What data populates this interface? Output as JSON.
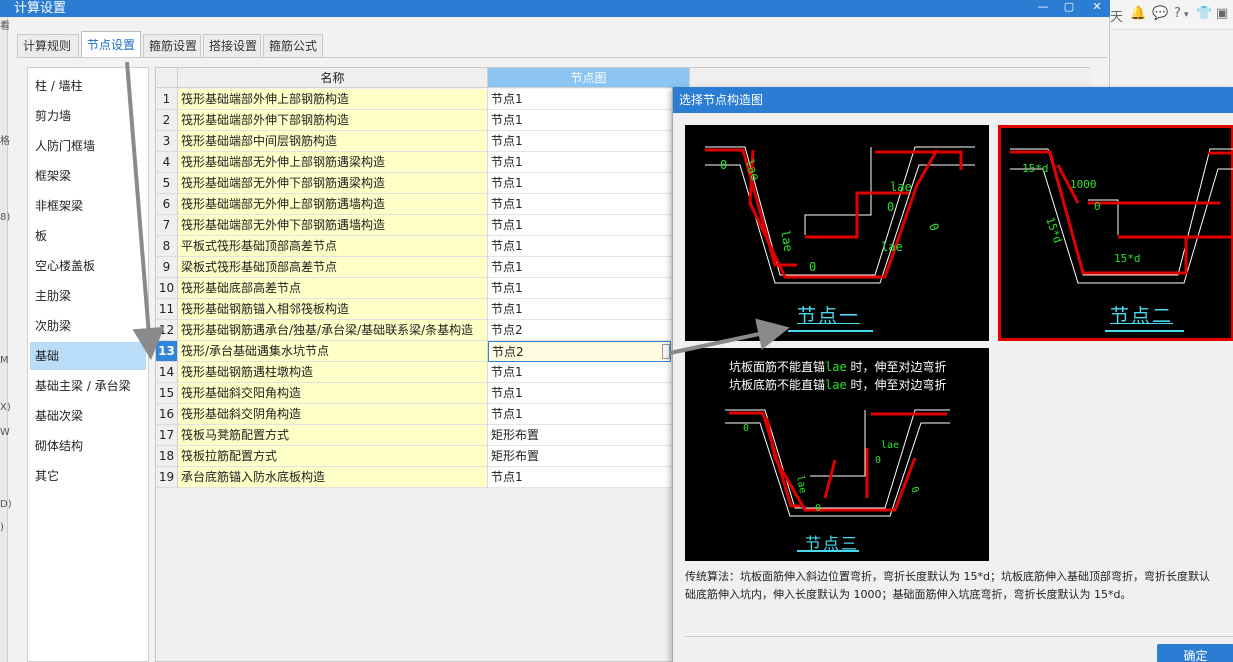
{
  "window": {
    "title": "计算设置",
    "controls": [
      "—",
      "▢",
      "✕"
    ]
  },
  "app_bar": {
    "items": [
      "天",
      "🔔",
      "💬",
      "?",
      "▾",
      "👕",
      "▣"
    ]
  },
  "left_edge": {
    "glyphs": [
      "看",
      "8)",
      "格",
      "M",
      "X)",
      "W",
      "D)",
      ")"
    ]
  },
  "tabs": [
    "计算规则",
    "节点设置",
    "箍筋设置",
    "搭接设置",
    "箍筋公式"
  ],
  "active_tab": 1,
  "categories": [
    "柱 / 墙柱",
    "剪力墙",
    "人防门框墙",
    "框架梁",
    "非框架梁",
    "板",
    "空心楼盖板",
    "主肋梁",
    "次肋梁",
    "基础",
    "基础主梁 / 承台梁",
    "基础次梁",
    "砌体结构",
    "其它"
  ],
  "active_category": 9,
  "grid": {
    "headers": {
      "name": "名称",
      "node": "节点图"
    },
    "current_row": 12,
    "rows": [
      {
        "num": "1",
        "name": "筏形基础端部外伸上部钢筋构造",
        "value": "节点1"
      },
      {
        "num": "2",
        "name": "筏形基础端部外伸下部钢筋构造",
        "value": "节点1"
      },
      {
        "num": "3",
        "name": "筏形基础端部中间层钢筋构造",
        "value": "节点1"
      },
      {
        "num": "4",
        "name": "筏形基础端部无外伸上部钢筋遇梁构造",
        "value": "节点1"
      },
      {
        "num": "5",
        "name": "筏形基础端部无外伸下部钢筋遇梁构造",
        "value": "节点1"
      },
      {
        "num": "6",
        "name": "筏形基础端部无外伸上部钢筋遇墙构造",
        "value": "节点1"
      },
      {
        "num": "7",
        "name": "筏形基础端部无外伸下部钢筋遇墙构造",
        "value": "节点1"
      },
      {
        "num": "8",
        "name": "平板式筏形基础顶部高差节点",
        "value": "节点1"
      },
      {
        "num": "9",
        "name": "梁板式筏形基础顶部高差节点",
        "value": "节点1"
      },
      {
        "num": "10",
        "name": "筏形基础底部高差节点",
        "value": "节点1"
      },
      {
        "num": "11",
        "name": "筏形基础钢筋锚入相邻筏板构造",
        "value": "节点1"
      },
      {
        "num": "12",
        "name": "筏形基础钢筋遇承台/独基/承台梁/基础联系梁/条基构造",
        "value": "节点2"
      },
      {
        "num": "13",
        "name": "筏形/承台基础遇集水坑节点",
        "value": "节点2"
      },
      {
        "num": "14",
        "name": "筏形基础钢筋遇柱墩构造",
        "value": "节点1"
      },
      {
        "num": "15",
        "name": "筏形基础斜交阳角构造",
        "value": "节点1"
      },
      {
        "num": "16",
        "name": "筏形基础斜交阴角构造",
        "value": "节点1"
      },
      {
        "num": "17",
        "name": "筏板马凳筋配置方式",
        "value": "矩形布置"
      },
      {
        "num": "18",
        "name": "筏板拉筋配置方式",
        "value": "矩形布置"
      },
      {
        "num": "19",
        "name": "承台底筋锚入防水底板构造",
        "value": "节点1"
      }
    ]
  },
  "panel": {
    "title": "选择节点构造图",
    "nodes": [
      {
        "caption": "节点一",
        "labels": [
          "0",
          "lae",
          "lae",
          "0",
          "0",
          "lae",
          "lae",
          "0"
        ]
      },
      {
        "caption": "节点二",
        "labels": [
          "15*d",
          "1000",
          "0",
          "15*d",
          "15*d"
        ]
      },
      {
        "caption": "节点三",
        "labels": [
          "0",
          "lae",
          "0",
          "lae",
          "0",
          "0"
        ]
      }
    ],
    "selected_node": 1,
    "node3_note": [
      {
        "pre": "坑板面筋不能直锚",
        "code": "lae",
        "post": " 时，伸至对边弯折"
      },
      {
        "pre": "坑板底筋不能直锚",
        "code": "lae",
        "post": " 时，伸至对边弯折"
      }
    ],
    "description": [
      "传统算法：坑板面筋伸入斜边位置弯折，弯折长度默认为 15*d；坑板底筋伸入基础顶部弯折，弯折长度默认",
      "础底筋伸入坑内，伸入长度默认为 1000；基础面筋伸入坑底弯折，弯折长度默认为 15*d。"
    ],
    "ok_label": "确定"
  },
  "colors": {
    "accent": "#2b7cd3",
    "name_cell": "#ffffc8",
    "selected_category": "#b9dcf8",
    "rebar": "#e00000",
    "dimension": "#2de02d",
    "caption": "#48d8f0"
  }
}
